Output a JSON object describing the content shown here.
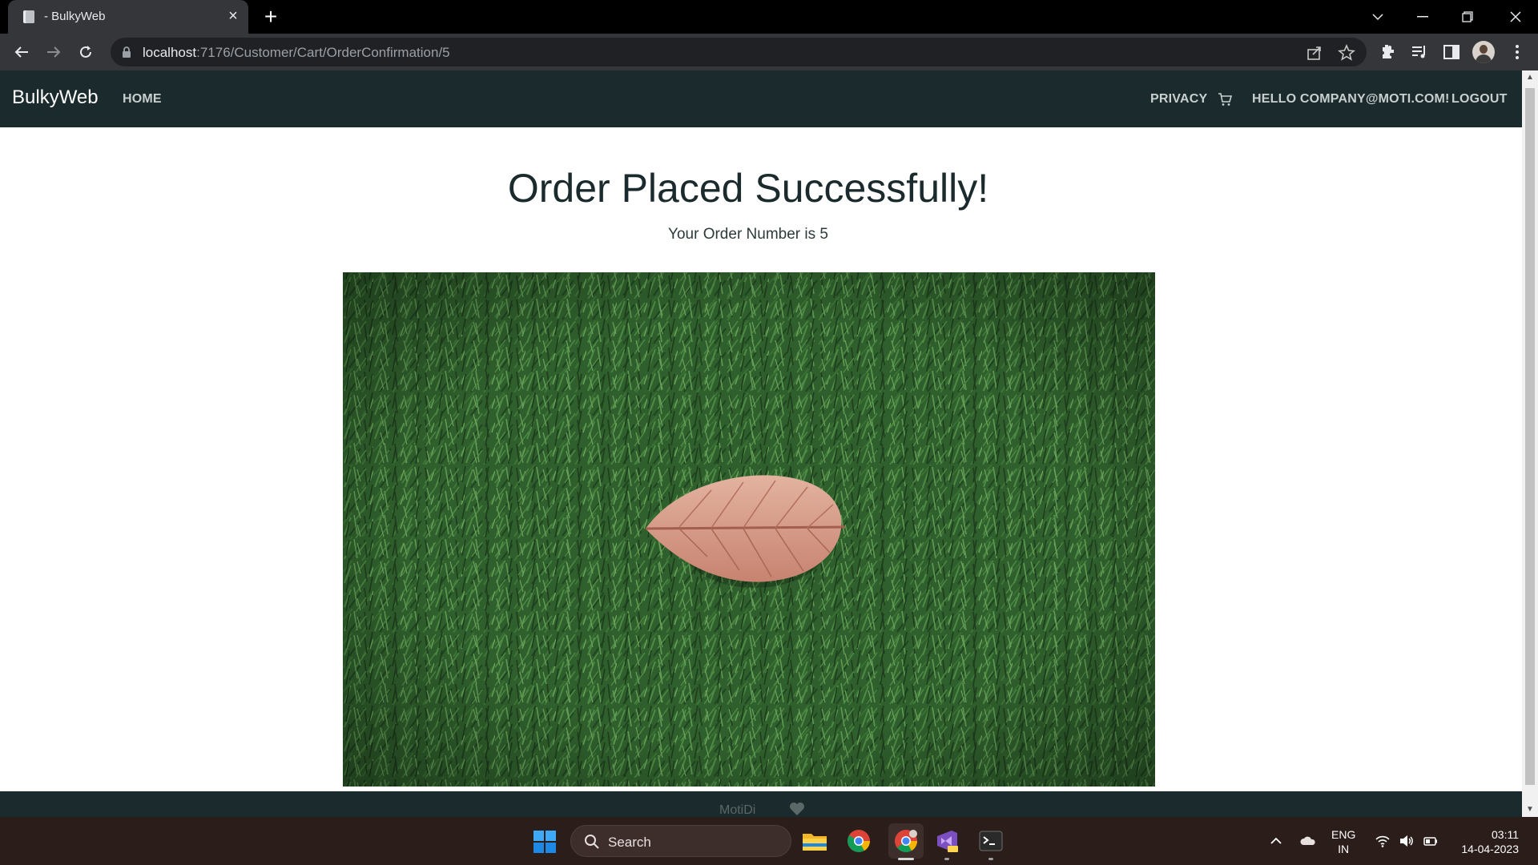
{
  "browser": {
    "tab_title": "- BulkyWeb",
    "url_host": "localhost",
    "url_path": ":7176/Customer/Cart/OrderConfirmation/5"
  },
  "site": {
    "brand": "BulkyWeb",
    "nav_home": "HOME",
    "nav_privacy": "PRIVACY",
    "nav_hello": "HELLO COMPANY@MOTI.COM!",
    "nav_logout": "LOGOUT"
  },
  "main": {
    "heading": "Order Placed Successfully!",
    "order_text": "Your Order Number is 5",
    "image_subject": "dry leaf lying on green grass"
  },
  "footer": {
    "text": "MotiDi"
  },
  "taskbar": {
    "search_label": "Search",
    "lang_line1": "ENG",
    "lang_line2": "IN",
    "time": "03:11",
    "date": "14-04-2023",
    "apps": [
      "file-explorer",
      "chrome",
      "chrome-profile",
      "visual-studio-preview",
      "terminal"
    ]
  },
  "colors": {
    "navbar": "#1b2a2c",
    "heading": "#1b2a2c",
    "grass": "#2f5f2c",
    "leaf": "#d49a86",
    "taskbar": "#2b1d1a"
  }
}
